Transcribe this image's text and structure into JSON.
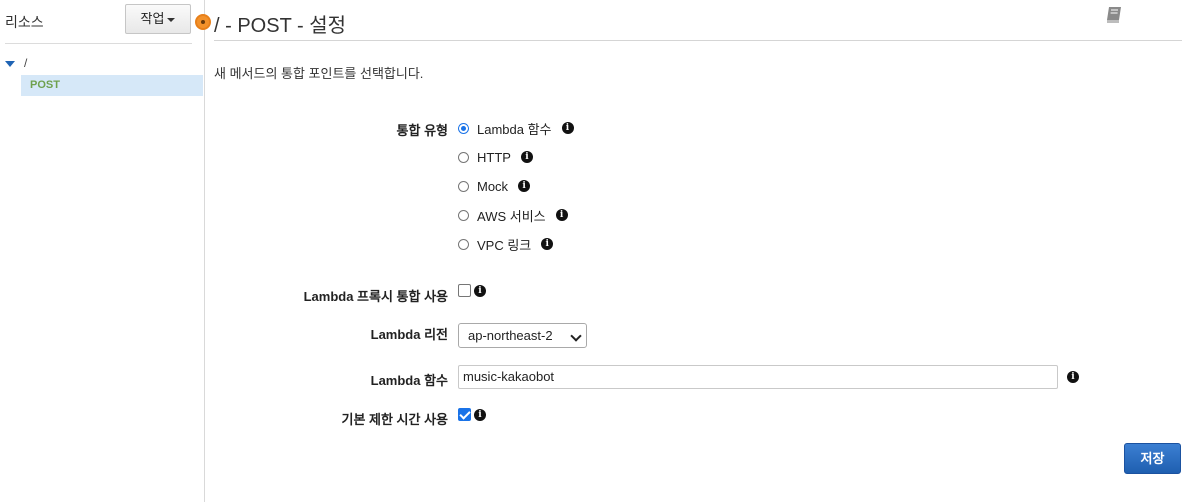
{
  "sidebar": {
    "title": "리소스",
    "actions_label": "작업",
    "tree": {
      "root": "/",
      "selected_child": "POST"
    }
  },
  "main": {
    "title": "/ - POST - 설정",
    "intro": "새 메서드의 통합 포인트를 선택합니다.",
    "integration_type": {
      "label": "통합 유형",
      "options": [
        "Lambda 함수",
        "HTTP",
        "Mock",
        "AWS 서비스",
        "VPC 링크"
      ],
      "selected": "Lambda 함수"
    },
    "proxy": {
      "label": "Lambda 프록시 통합 사용",
      "checked": false
    },
    "region": {
      "label": "Lambda 리전",
      "value": "ap-northeast-2"
    },
    "function": {
      "label": "Lambda 함수",
      "value": "music-kakaobot"
    },
    "timeout": {
      "label": "기본 제한 시간 사용",
      "checked": true
    },
    "save_label": "저장"
  },
  "icons": {
    "info": "info-icon",
    "docs": "book-icon"
  },
  "colors": {
    "accent": "#1a73e8",
    "save_button": "#2a6cc4",
    "selected_row": "#d6e8f8",
    "post_text": "#6fa14e",
    "handle": "#f3912a"
  }
}
